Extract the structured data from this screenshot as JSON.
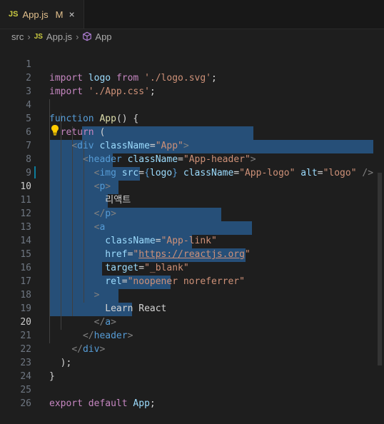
{
  "tab": {
    "icon": "JS",
    "filename": "App.js",
    "modified": "M",
    "close": "×"
  },
  "breadcrumb": {
    "folder": "src",
    "file_icon": "JS",
    "file": "App.js",
    "symbol": "App"
  },
  "line_numbers": [
    "1",
    "2",
    "3",
    "4",
    "5",
    "6",
    "7",
    "8",
    "9",
    "10",
    "11",
    "12",
    "13",
    "14",
    "15",
    "16",
    "17",
    "18",
    "19",
    "20",
    "21",
    "22",
    "23",
    "24",
    "25",
    "26"
  ],
  "tokens": {
    "import": "import",
    "logo": "logo",
    "from": "from",
    "logo_path": "'./logo.svg'",
    "semi": ";",
    "css_path": "'./App.css'",
    "function": "function",
    "app": "App",
    "parens_brace": "() {",
    "return": "return",
    "open_paren": "(",
    "lt": "<",
    "gt": ">",
    "lt_slash": "</",
    "self_close": "/>",
    "div": "div",
    "className": "className",
    "eq": "=",
    "app_str": "\"App\"",
    "header": "header",
    "app_header_str": "\"App-header\"",
    "img": "img",
    "src": "src",
    "brace_logo_open": "{",
    "brace_logo_close": "}",
    "app_logo_str": "\"App-logo\"",
    "alt": "alt",
    "logo_str": "\"logo\"",
    "p": "p",
    "korean_text": "리액트",
    "a": "a",
    "app_link_str": "\"App-link\"",
    "href": "href",
    "href_url": "https://reactjs.org",
    "quote": "\"",
    "target": "target",
    "blank_str": "\"_blank\"",
    "rel": "rel",
    "rel_str": "\"noopener noreferrer\"",
    "learn_react": "Learn React",
    "close_paren_semi": ");",
    "close_brace": "}",
    "export": "export",
    "default": "default"
  },
  "colors": {
    "background": "#1e1e1e",
    "selection": "#264f78",
    "keyword": "#c586c0",
    "string": "#ce9178",
    "variable": "#9cdcfe",
    "tag": "#569cd6",
    "function": "#dcdcaa"
  },
  "icons": {
    "lightbulb": "lightbulb-icon",
    "symbol": "symbol-class-icon"
  }
}
